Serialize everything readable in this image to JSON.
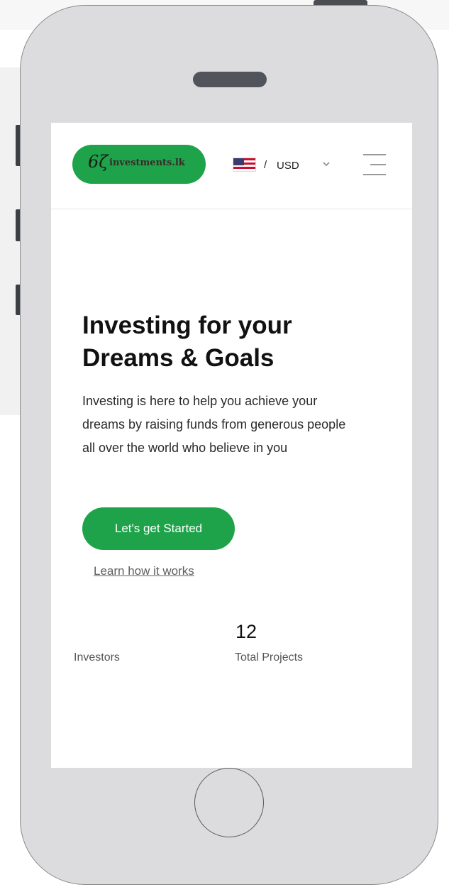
{
  "header": {
    "logo_mark": "6ζ",
    "logo_text": "investments.lk",
    "currency_separator": "/",
    "currency": "USD",
    "flag_icon": "us-flag-icon"
  },
  "hero": {
    "title": "Investing for your Dreams & Goals",
    "description": "Investing is here to help you achieve your dreams by raising funds from generous people all over the world who believe in you",
    "cta_label": "Let's get Started",
    "learn_link": "Learn how it works"
  },
  "stats": [
    {
      "value": "",
      "label": "Investors"
    },
    {
      "value": "12",
      "label": "Total Projects"
    }
  ],
  "colors": {
    "brand_green": "#1ea34a",
    "phone_body": "#dcdcde",
    "text_dark": "#111111"
  }
}
